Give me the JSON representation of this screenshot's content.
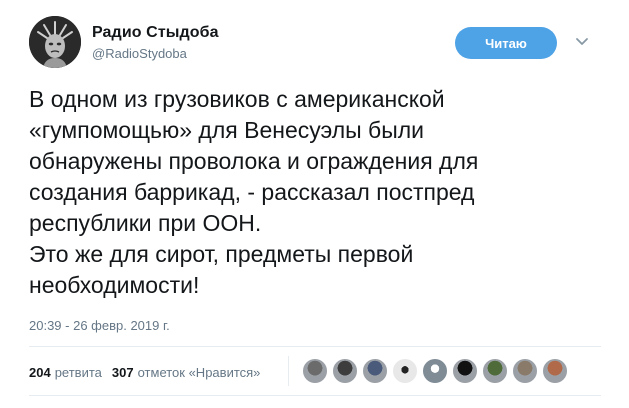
{
  "header": {
    "name": "Радио Стыдоба",
    "handle": "@RadioStydoba",
    "follow_label": "Читаю"
  },
  "tweet": {
    "text": "В одном из грузовиков с американской\n«гумпомощью» для Венесуэлы были\nобнаружены проволока и ограждения для\nсоздания баррикад, - рассказал постпред\nреспублики при ООН.\nЭто же для сирот, предметы первой\nнеобходимости!",
    "timestamp": "20:39 - 26 февр. 2019 г."
  },
  "stats": {
    "retweets_count": "204",
    "retweets_label": "ретвита",
    "likes_count": "307",
    "likes_label": "отметок «Нравится»"
  },
  "likers": [
    {
      "name": "liker-1",
      "color": "#6b6b6b"
    },
    {
      "name": "liker-2",
      "color": "#3d3d3d"
    },
    {
      "name": "liker-3",
      "color": "#4a5a7a"
    },
    {
      "name": "liker-4",
      "color": "#d8d8d8"
    },
    {
      "name": "liker-5",
      "color": "#7f8c96"
    },
    {
      "name": "liker-6",
      "color": "#111111"
    },
    {
      "name": "liker-7",
      "color": "#4f6b3a"
    },
    {
      "name": "liker-8",
      "color": "#8a7a6a"
    },
    {
      "name": "liker-9",
      "color": "#b06a4a"
    }
  ],
  "colors": {
    "follow_button": "#4ea2e6",
    "secondary_text": "#657786",
    "primary_text": "#14171a"
  },
  "icons": {
    "avatar": "statue-of-liberty-avatar",
    "menu": "chevron-down-icon"
  }
}
